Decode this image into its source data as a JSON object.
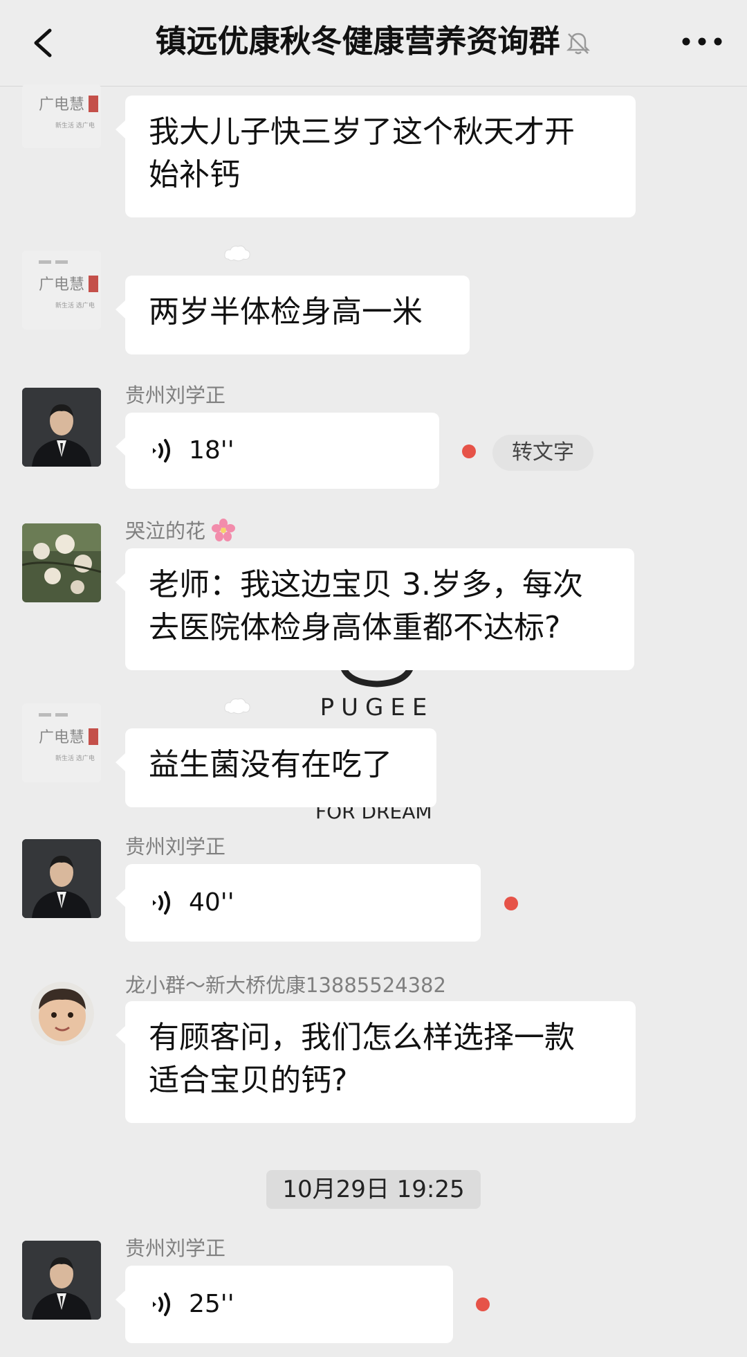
{
  "header": {
    "title": "镇远优康秋冬健康营养资询群"
  },
  "watermark": {
    "brand": "PUGEE",
    "sub_line1": "EE",
    "sub_line2": "FOR DREAM"
  },
  "avatars": {
    "logo_text": "广电慧",
    "logo_sub": "新生活 选广电"
  },
  "messages": [
    {
      "type": "text",
      "sender": "",
      "text_lines": [
        "我大儿子快三岁了这个秋天才开",
        "始补钙"
      ]
    },
    {
      "type": "text",
      "sender": "",
      "text_lines": [
        "两岁半体检身高一米"
      ]
    },
    {
      "type": "voice",
      "sender": "贵州刘学正",
      "duration": "18''",
      "unread": true,
      "convert_label": "转文字"
    },
    {
      "type": "text",
      "sender": "哭泣的花",
      "text_lines": [
        "老师：我这边宝贝 3.岁多，每次",
        "去医院体检身高体重都不达标?"
      ]
    },
    {
      "type": "text",
      "sender": "",
      "text_lines": [
        "益生菌没有在吃了"
      ]
    },
    {
      "type": "voice",
      "sender": "贵州刘学正",
      "duration": "40''",
      "unread": true
    },
    {
      "type": "text",
      "sender": "龙小群～新大桥优康13885524382",
      "text_lines": [
        "有顾客问，我们怎么样选择一款",
        "适合宝贝的钙?"
      ]
    },
    {
      "type": "timestamp",
      "text": "10月29日 19:25"
    },
    {
      "type": "voice",
      "sender": "贵州刘学正",
      "duration": "25''",
      "unread": true
    }
  ],
  "colors": {
    "background": "#ececec",
    "bubble": "#ffffff",
    "unread_dot": "#e65348",
    "name": "#7f7f7f"
  },
  "icons": [
    "back-arrow-icon",
    "mute-bell-icon",
    "more-dots-icon",
    "voice-wave-icon",
    "thought-bubble-icon"
  ]
}
